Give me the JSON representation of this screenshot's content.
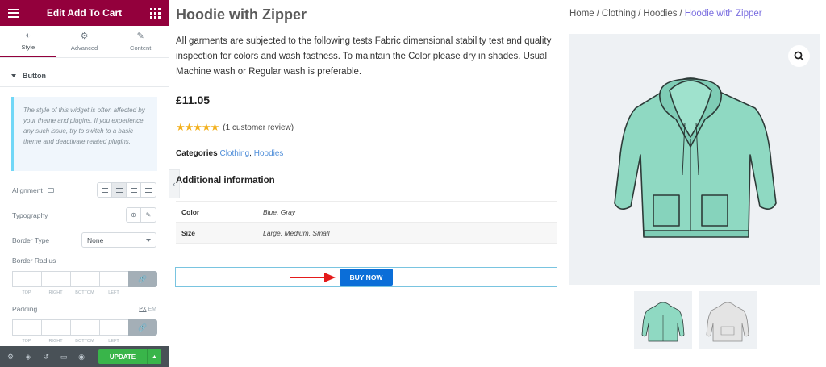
{
  "editor": {
    "title": "Edit Add To Cart",
    "tabs": [
      {
        "label": "Style",
        "icon": "half-circle-icon"
      },
      {
        "label": "Advanced",
        "icon": "gear-icon"
      },
      {
        "label": "Content",
        "icon": "pencil-icon"
      }
    ],
    "section": "Button",
    "notice": "The style of this widget is often affected by your theme and plugins. If you experience any such issue, try to switch to a basic theme and deactivate related plugins.",
    "alignment_label": "Alignment",
    "typography_label": "Typography",
    "border_type_label": "Border Type",
    "border_type_value": "None",
    "border_radius_label": "Border Radius",
    "padding_label": "Padding",
    "dim_labels": [
      "TOP",
      "RIGHT",
      "BOTTOM",
      "LEFT"
    ],
    "unit_px": "PX",
    "unit_em": "EM",
    "update_label": "UPDATE"
  },
  "product": {
    "title": "Hoodie with Zipper",
    "description": "All garments are subjected to the following tests Fabric dimensional stability test and quality inspection for colors and wash fastness. To maintain the Color please dry in shades. Usual Machine wash or Regular wash is preferable.",
    "price": "£11.05",
    "rating": 5,
    "review_text": "(1 customer review)",
    "categories_label": "Categories",
    "categories": [
      "Clothing",
      "Hoodies"
    ],
    "additional_info_title": "Additional information",
    "attributes": [
      {
        "name": "Color",
        "value": "Blue, Gray"
      },
      {
        "name": "Size",
        "value": "Large, Medium, Small"
      }
    ],
    "buy_label": "BUY NOW"
  },
  "breadcrumb": {
    "items": [
      "Home",
      "Clothing",
      "Hoodies"
    ],
    "current": "Hoodie with Zipper",
    "separator": "/"
  },
  "colors": {
    "editor_brand": "#93003c",
    "buy_button": "#0b6ed8",
    "update_button": "#39b54a",
    "link": "#4f8ed9",
    "star": "#f2b01e",
    "hoodie_mint": "#8fd9c2",
    "hoodie_gray": "#e4e4e4"
  }
}
